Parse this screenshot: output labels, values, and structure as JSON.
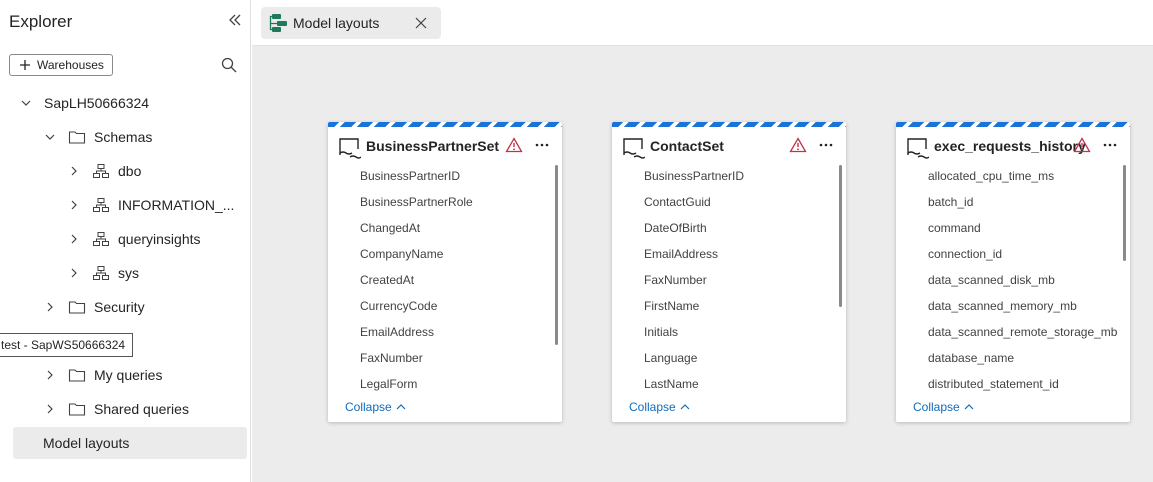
{
  "sidebar": {
    "title": "Explorer",
    "warehouses_button": "Warehouses",
    "tree": {
      "root": "SapLH50666324",
      "schemas": "Schemas",
      "schema_items": [
        "dbo",
        "INFORMATION_...",
        "queryinsights",
        "sys"
      ],
      "security": "Security",
      "my_queries": "My queries",
      "shared_queries": "Shared queries",
      "model_layouts": "Model layouts"
    },
    "tooltip": "test - SapWS50666324"
  },
  "tab": {
    "label": "Model layouts"
  },
  "tables": [
    {
      "name": "BusinessPartnerSet",
      "columns": [
        "BusinessPartnerID",
        "BusinessPartnerRole",
        "ChangedAt",
        "CompanyName",
        "CreatedAt",
        "CurrencyCode",
        "EmailAddress",
        "FaxNumber",
        "LegalForm"
      ],
      "collapse_label": "Collapse"
    },
    {
      "name": "ContactSet",
      "columns": [
        "BusinessPartnerID",
        "ContactGuid",
        "DateOfBirth",
        "EmailAddress",
        "FaxNumber",
        "FirstName",
        "Initials",
        "Language",
        "LastName"
      ],
      "collapse_label": "Collapse"
    },
    {
      "name": "exec_requests_history",
      "columns": [
        "allocated_cpu_time_ms",
        "batch_id",
        "command",
        "connection_id",
        "data_scanned_disk_mb",
        "data_scanned_memory_mb",
        "data_scanned_remote_storage_mb",
        "database_name",
        "distributed_statement_id"
      ],
      "collapse_label": "Collapse"
    }
  ],
  "colors": {
    "accent_stripe": "#1a73d9",
    "warning": "#c4314b",
    "link": "#0f6cbd",
    "canvas": "#ececec"
  }
}
